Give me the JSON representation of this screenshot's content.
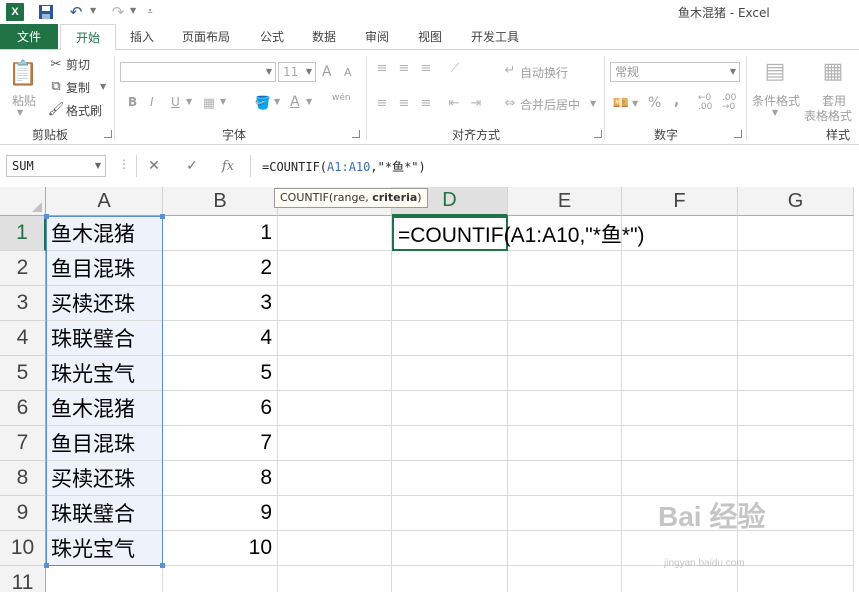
{
  "titlebar": {
    "title": "鱼木混猪 - Excel",
    "app_icon": "X"
  },
  "tabs": {
    "file": "文件",
    "items": [
      "开始",
      "插入",
      "页面布局",
      "公式",
      "数据",
      "审阅",
      "视图",
      "开发工具"
    ],
    "active": "开始"
  },
  "ribbon": {
    "clipboard": {
      "paste": "粘贴",
      "cut": "剪切",
      "copy": "复制",
      "format_painter": "格式刷",
      "label": "剪贴板"
    },
    "font": {
      "name": "",
      "size": "11",
      "bold": "B",
      "italic": "I",
      "underline": "U",
      "grow": "A",
      "shrink": "A",
      "phonetic": "wén",
      "label": "字体"
    },
    "alignment": {
      "wrap_text": "自动换行",
      "merge_center": "合并后居中",
      "label": "对齐方式"
    },
    "number": {
      "format": "常规",
      "percent": "%",
      "comma": ",",
      "label": "数字"
    },
    "styles": {
      "conditional": "条件格式",
      "table_line1": "套用",
      "table_line2": "表格格式",
      "label": "样式"
    }
  },
  "formula_bar": {
    "name_box": "SUM",
    "cancel": "✕",
    "enter": "✓",
    "fx": "fx",
    "prefix": "=COUNTIF(",
    "ref": "A1:A10",
    "suffix": ",\"*鱼*\")"
  },
  "tooltip": {
    "func": "COUNTIF(",
    "arg1": "range",
    "sep": ", ",
    "arg2": "criteria",
    "close": ")"
  },
  "sheet": {
    "columns": [
      "A",
      "B",
      "C",
      "D",
      "E",
      "F",
      "G"
    ],
    "selected_column": "D",
    "rows": [
      {
        "n": "1",
        "a": "鱼木混猪",
        "b": "1"
      },
      {
        "n": "2",
        "a": "鱼目混珠",
        "b": "2"
      },
      {
        "n": "3",
        "a": "买椟还珠",
        "b": "3"
      },
      {
        "n": "4",
        "a": "珠联璧合",
        "b": "4"
      },
      {
        "n": "5",
        "a": "珠光宝气",
        "b": "5"
      },
      {
        "n": "6",
        "a": "鱼木混猪",
        "b": "6"
      },
      {
        "n": "7",
        "a": "鱼目混珠",
        "b": "7"
      },
      {
        "n": "8",
        "a": "买椟还珠",
        "b": "8"
      },
      {
        "n": "9",
        "a": "珠联璧合",
        "b": "9"
      },
      {
        "n": "10",
        "a": "珠光宝气",
        "b": "10"
      },
      {
        "n": "11",
        "a": "",
        "b": ""
      }
    ],
    "active_cell_text": "=COUNTIF(A1:A10,\"*鱼*\")"
  },
  "watermark": {
    "main": "Bai 经验",
    "sub": "jingyan.baidu.com"
  },
  "colors": {
    "excel_green": "#217346",
    "range_blue": "#5b8fd4"
  }
}
